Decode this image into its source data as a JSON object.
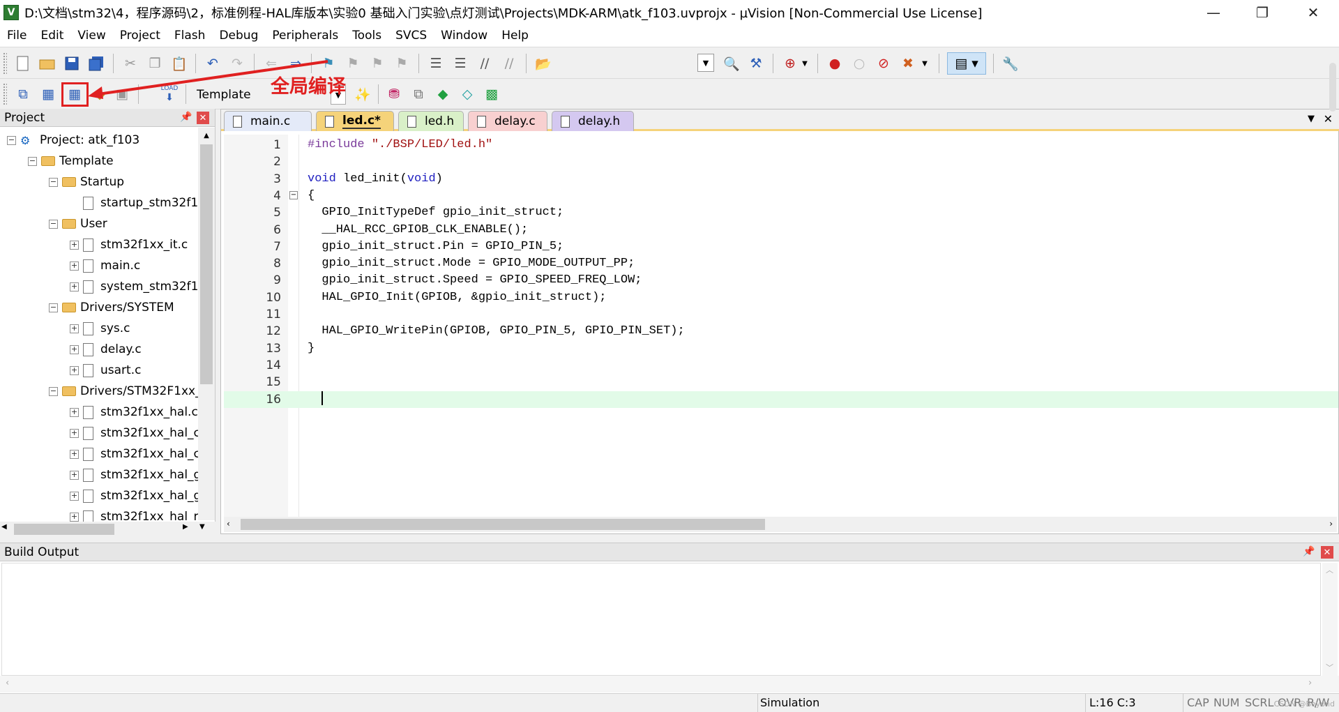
{
  "window": {
    "title": "D:\\文档\\stm32\\4，程序源码\\2，标准例程-HAL库版本\\实验0 基础入门实验\\点灯测试\\Projects\\MDK-ARM\\atk_f103.uvprojx - µVision  [Non-Commercial Use License]",
    "app_icon": "V",
    "controls": {
      "minimize": "—",
      "maximize": "❐",
      "close": "✕"
    }
  },
  "menu": [
    "File",
    "Edit",
    "View",
    "Project",
    "Flash",
    "Debug",
    "Peripherals",
    "Tools",
    "SVCS",
    "Window",
    "Help"
  ],
  "toolbar2": {
    "target": "Template",
    "load_label": "LOAD"
  },
  "annotation": {
    "text": "全局编译"
  },
  "project_panel": {
    "title": "Project",
    "pin": "📌",
    "close": "✕",
    "tree": [
      {
        "label": "Project: atk_f103",
        "type": "project",
        "expander": "−"
      },
      {
        "label": "Template",
        "type": "folder",
        "expander": "−"
      },
      {
        "label": "Startup",
        "type": "folder",
        "expander": "−"
      },
      {
        "label": "startup_stm32f1(",
        "type": "file",
        "expander": ""
      },
      {
        "label": "User",
        "type": "folder",
        "expander": "−"
      },
      {
        "label": "stm32f1xx_it.c",
        "type": "file",
        "expander": "+"
      },
      {
        "label": "main.c",
        "type": "file",
        "expander": "+"
      },
      {
        "label": "system_stm32f1:",
        "type": "file",
        "expander": "+"
      },
      {
        "label": "Drivers/SYSTEM",
        "type": "folder",
        "expander": "−"
      },
      {
        "label": "sys.c",
        "type": "file",
        "expander": "+"
      },
      {
        "label": "delay.c",
        "type": "file",
        "expander": "+"
      },
      {
        "label": "usart.c",
        "type": "file",
        "expander": "+"
      },
      {
        "label": "Drivers/STM32F1xx_",
        "type": "folder",
        "expander": "−"
      },
      {
        "label": "stm32f1xx_hal.c",
        "type": "file",
        "expander": "+"
      },
      {
        "label": "stm32f1xx_hal_c",
        "type": "file",
        "expander": "+"
      },
      {
        "label": "stm32f1xx_hal_c",
        "type": "file",
        "expander": "+"
      },
      {
        "label": "stm32f1xx_hal_g",
        "type": "file",
        "expander": "+"
      },
      {
        "label": "stm32f1xx_hal_g",
        "type": "file",
        "expander": "+"
      },
      {
        "label": "stm32f1xx_hal_r",
        "type": "file",
        "expander": "+"
      }
    ]
  },
  "editor": {
    "tabs": [
      {
        "label": "main.c",
        "color": "#e4eaf8",
        "active": false
      },
      {
        "label": "led.c*",
        "color": "#f5d37a",
        "active": true
      },
      {
        "label": "led.h",
        "color": "#d9f0c8",
        "active": false
      },
      {
        "label": "delay.c",
        "color": "#f8d0d0",
        "active": false
      },
      {
        "label": "delay.h",
        "color": "#d4c8f0",
        "active": false
      }
    ],
    "tab_menu": "▼",
    "tab_close": "✕",
    "lines": [
      {
        "n": "1",
        "segments": [
          {
            "t": "#include ",
            "c": "pp"
          },
          {
            "t": "\"./BSP/LED/led.h\"",
            "c": "str"
          }
        ]
      },
      {
        "n": "2",
        "segments": []
      },
      {
        "n": "3",
        "segments": [
          {
            "t": "void",
            "c": "kw"
          },
          {
            "t": " led_init(",
            "c": ""
          },
          {
            "t": "void",
            "c": "kw"
          },
          {
            "t": ")",
            "c": ""
          }
        ]
      },
      {
        "n": "4",
        "segments": [
          {
            "t": "{",
            "c": ""
          }
        ],
        "fold": "−"
      },
      {
        "n": "5",
        "segments": [
          {
            "t": "  GPIO_InitTypeDef gpio_init_struct;",
            "c": ""
          }
        ]
      },
      {
        "n": "6",
        "segments": [
          {
            "t": "  __HAL_RCC_GPIOB_CLK_ENABLE();",
            "c": ""
          }
        ]
      },
      {
        "n": "7",
        "segments": [
          {
            "t": "  gpio_init_struct.Pin = GPIO_PIN_5;",
            "c": ""
          }
        ]
      },
      {
        "n": "8",
        "segments": [
          {
            "t": "  gpio_init_struct.Mode = GPIO_MODE_OUTPUT_PP;",
            "c": ""
          }
        ]
      },
      {
        "n": "9",
        "segments": [
          {
            "t": "  gpio_init_struct.Speed = GPIO_SPEED_FREQ_LOW;",
            "c": ""
          }
        ]
      },
      {
        "n": "10",
        "segments": [
          {
            "t": "  HAL_GPIO_Init(GPIOB, &gpio_init_struct);",
            "c": ""
          }
        ]
      },
      {
        "n": "11",
        "segments": []
      },
      {
        "n": "12",
        "segments": [
          {
            "t": "  HAL_GPIO_WritePin(GPIOB, GPIO_PIN_5, GPIO_PIN_SET);",
            "c": ""
          }
        ]
      },
      {
        "n": "13",
        "segments": [
          {
            "t": "}",
            "c": ""
          }
        ]
      },
      {
        "n": "14",
        "segments": []
      },
      {
        "n": "15",
        "segments": []
      },
      {
        "n": "16",
        "segments": [
          {
            "t": "  ",
            "c": ""
          }
        ],
        "active": true
      }
    ]
  },
  "build_output": {
    "title": "Build Output",
    "pin": "📌",
    "close": "✕"
  },
  "status": {
    "mode": "Simulation",
    "position": "L:16 C:3",
    "indicators": [
      "CAP",
      "NUM",
      "SCRL",
      "OVR",
      "R/W"
    ],
    "watermark": "CSDN @Beyond"
  },
  "colors": {
    "annotation": "#e02020",
    "active_line": "#e2fbe8",
    "active_tab": "#f5d37a"
  }
}
